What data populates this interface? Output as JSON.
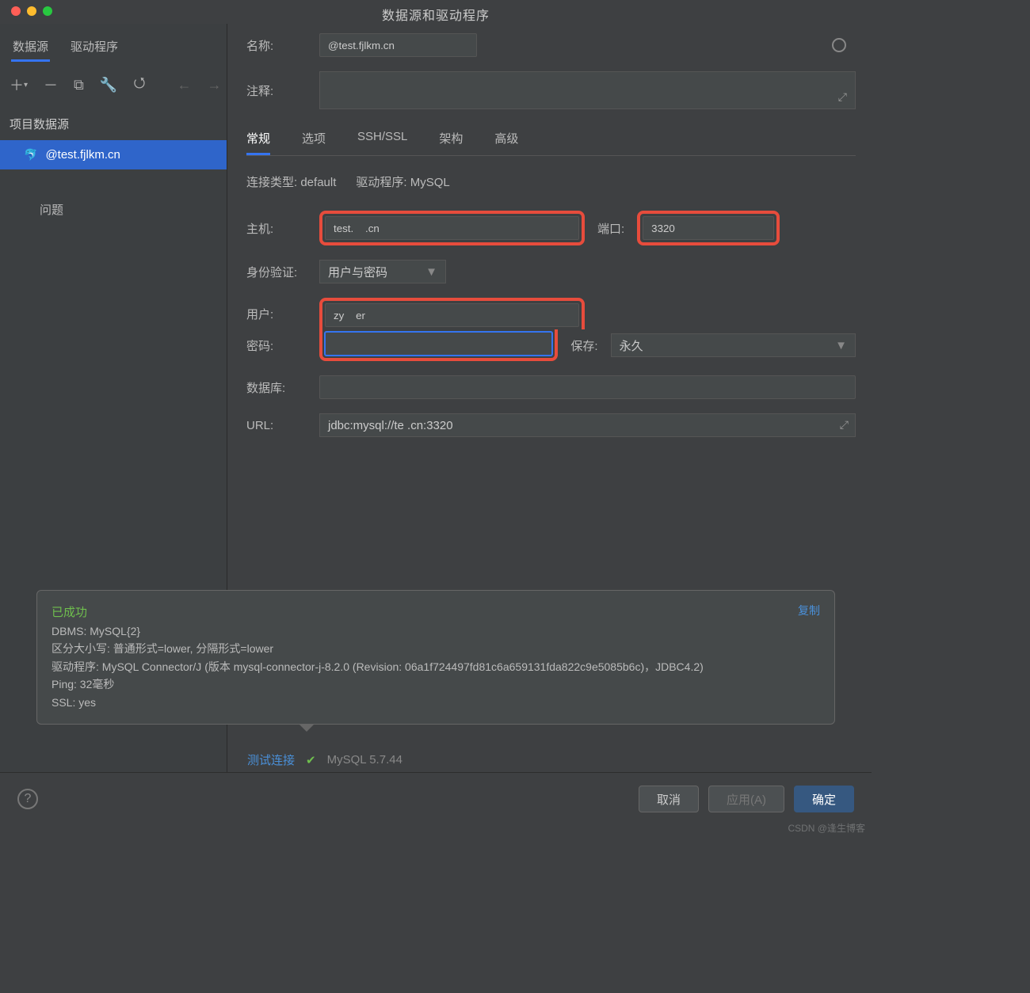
{
  "title": "数据源和驱动程序",
  "sideTabs": {
    "ds": "数据源",
    "drv": "驱动程序"
  },
  "sideHeader": "项目数据源",
  "dsName": "@test.fjlkm.cn",
  "problem": "问题",
  "labels": {
    "name": "名称:",
    "comment": "注释:",
    "host": "主机:",
    "port": "端口:",
    "auth": "身份验证:",
    "user": "用户:",
    "pass": "密码:",
    "save": "保存:",
    "db": "数据库:",
    "url": "URL:",
    "connType": "连接类型:",
    "driver": "驱动程序:"
  },
  "values": {
    "name": "@test.fjlkm.cn",
    "host": "test.    .cn",
    "port": "3320",
    "auth": "用户与密码",
    "user": "zy    er",
    "save": "永久",
    "connType": "default",
    "driver": "MySQL",
    "url": "jdbc:mysql://te        .cn:3320"
  },
  "tabs": {
    "general": "常规",
    "options": "选项",
    "ssh": "SSH/SSL",
    "schema": "架构",
    "adv": "高级"
  },
  "popup": {
    "ok": "已成功",
    "copy": "复制",
    "l1": "DBMS: MySQL{2}",
    "l2": "区分大小写: 普通形式=lower, 分隔形式=lower",
    "l3": "驱动程序: MySQL Connector/J (版本 mysql-connector-j-8.2.0 (Revision: 06a1f724497fd81c6a659131fda822c9e5085b6c)，JDBC4.2)",
    "l4": "Ping: 32毫秒",
    "l5": "SSL: yes"
  },
  "test": {
    "label": "测试连接",
    "version": "MySQL 5.7.44"
  },
  "footer": {
    "cancel": "取消",
    "apply": "应用(A)",
    "ok": "确定"
  },
  "watermark": "CSDN @逢生博客"
}
